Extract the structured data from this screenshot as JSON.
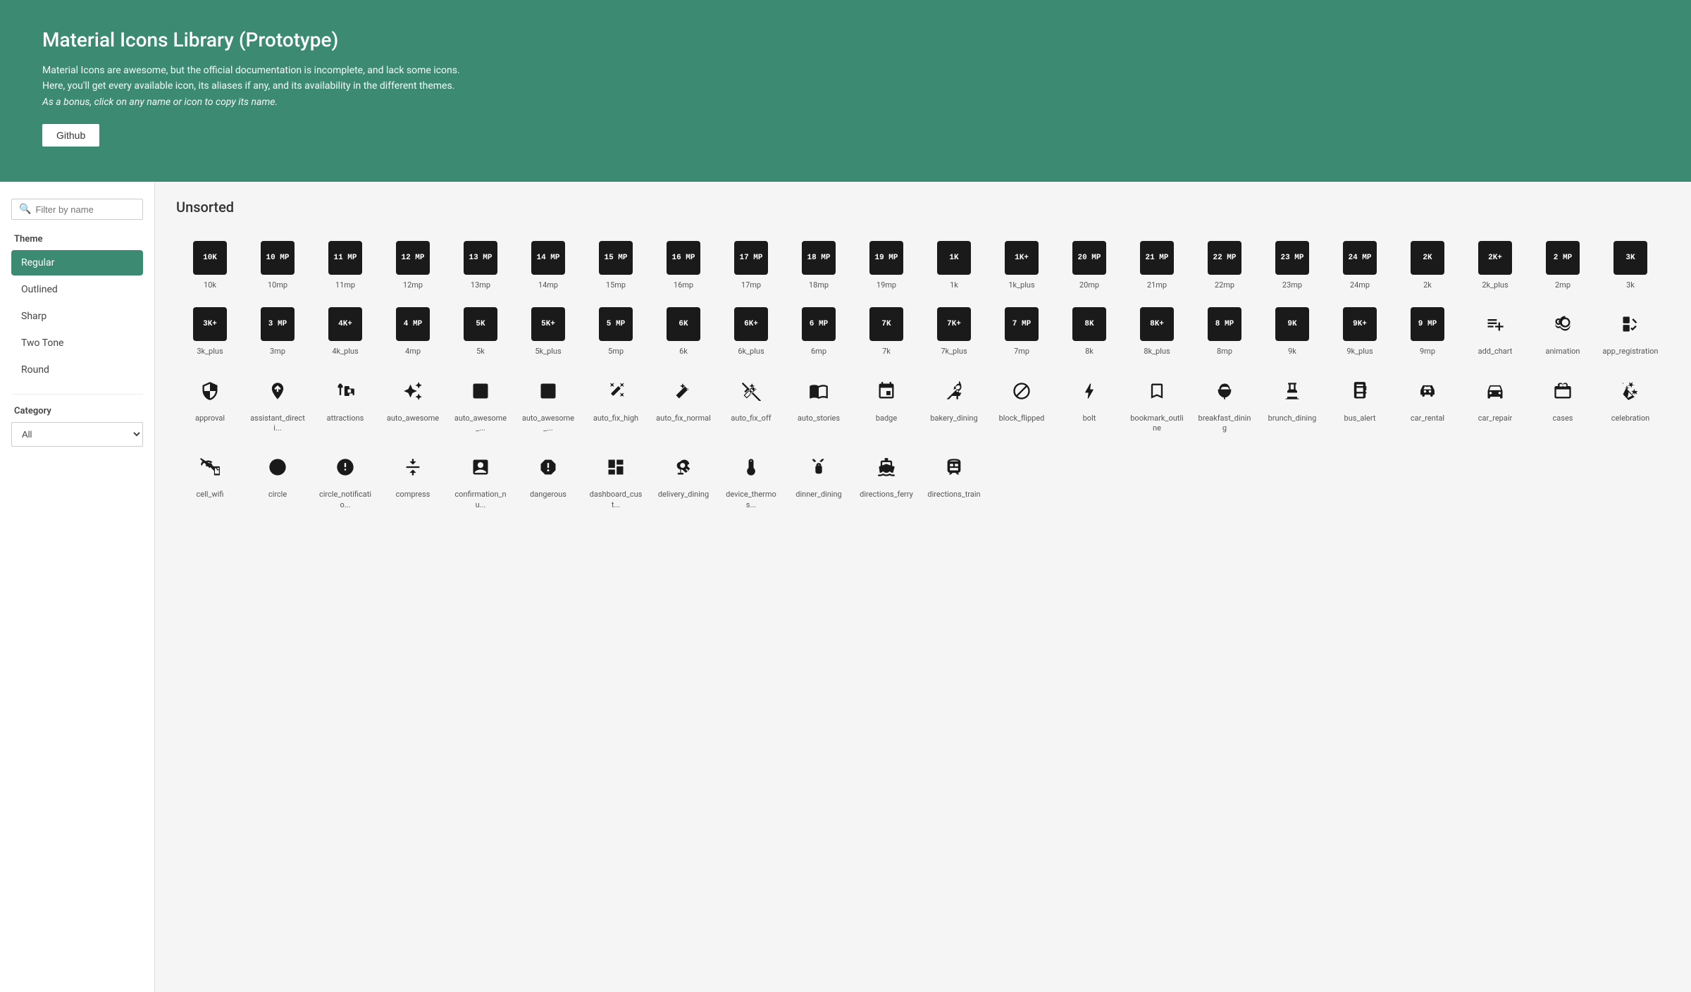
{
  "header": {
    "title": "Material Icons Library (Prototype)",
    "desc1": "Material Icons are awesome, but the official documentation is incomplete, and lack some icons.",
    "desc2": "Here, you'll get every available icon, its aliases if any, and its availability in the different themes.",
    "desc3": "As a bonus, click on any name or icon to copy its name.",
    "github_label": "Github"
  },
  "sidebar": {
    "search_placeholder": "Filter by name",
    "theme_label": "Theme",
    "themes": [
      {
        "id": "regular",
        "label": "Regular",
        "active": true
      },
      {
        "id": "outlined",
        "label": "Outlined",
        "active": false
      },
      {
        "id": "sharp",
        "label": "Sharp",
        "active": false
      },
      {
        "id": "two-tone",
        "label": "Two Tone",
        "active": false
      },
      {
        "id": "round",
        "label": "Round",
        "active": false
      }
    ],
    "category_label": "Category",
    "category_options": [
      {
        "value": "all",
        "label": "All"
      }
    ]
  },
  "content": {
    "title": "Unsorted",
    "icons": [
      {
        "name": "10k",
        "display": "10K"
      },
      {
        "name": "10mp",
        "display": "10\nMP"
      },
      {
        "name": "11mp",
        "display": "11\nMP"
      },
      {
        "name": "12mp",
        "display": "12\nMP"
      },
      {
        "name": "13mp",
        "display": "13\nMP"
      },
      {
        "name": "14mp",
        "display": "14\nMP"
      },
      {
        "name": "15mp",
        "display": "15\nMP"
      },
      {
        "name": "16mp",
        "display": "16\nMP"
      },
      {
        "name": "17mp",
        "display": "17\nMP"
      },
      {
        "name": "18mp",
        "display": "18\nMP"
      },
      {
        "name": "19mp",
        "display": "19\nMP"
      },
      {
        "name": "1k",
        "display": "1K"
      },
      {
        "name": "1k_plus",
        "display": "1K+"
      },
      {
        "name": "20mp",
        "display": "20\nMP"
      },
      {
        "name": "21mp",
        "display": "21\nMP"
      },
      {
        "name": "22mp",
        "display": "22\nMP"
      },
      {
        "name": "23mp",
        "display": "23\nMP"
      },
      {
        "name": "24mp",
        "display": "24\nMP"
      },
      {
        "name": "2k",
        "display": "2K"
      },
      {
        "name": "2k_plus",
        "display": "2K+"
      },
      {
        "name": "2mp",
        "display": "2\nMP"
      },
      {
        "name": "3k",
        "display": "3K"
      },
      {
        "name": "3k_plus",
        "display": "3K+"
      },
      {
        "name": "3mp",
        "display": "3\nMP"
      },
      {
        "name": "4k_plus",
        "display": "4K+"
      },
      {
        "name": "4mp",
        "display": "4\nMP"
      },
      {
        "name": "5k",
        "display": "5K"
      },
      {
        "name": "5k_plus",
        "display": "5K+"
      },
      {
        "name": "5mp",
        "display": "5\nMP"
      },
      {
        "name": "6k",
        "display": "6K"
      },
      {
        "name": "6k_plus",
        "display": "6K+"
      },
      {
        "name": "6mp",
        "display": "6\nMP"
      },
      {
        "name": "7k",
        "display": "7K"
      },
      {
        "name": "7k_plus",
        "display": "7K+"
      },
      {
        "name": "7mp",
        "display": "7\nMP"
      },
      {
        "name": "8k",
        "display": "8K"
      },
      {
        "name": "8k_plus",
        "display": "8K+"
      },
      {
        "name": "8mp",
        "display": "8\nMP"
      },
      {
        "name": "9k",
        "display": "9K"
      },
      {
        "name": "9k_plus",
        "display": "9K+"
      },
      {
        "name": "9mp",
        "display": "9\nMP"
      },
      {
        "name": "add_chart",
        "display": "add_chart",
        "svg": true
      },
      {
        "name": "animation",
        "display": "animation",
        "svg": true
      },
      {
        "name": "app_registration",
        "display": "app_registration",
        "svg": true
      },
      {
        "name": "approval",
        "display": "approval",
        "svg": true
      },
      {
        "name": "assistant_directi...",
        "display": "assistant_directi",
        "svg": true
      },
      {
        "name": "attractions",
        "display": "attractions",
        "svg": true
      },
      {
        "name": "auto_awesome",
        "display": "auto_awesome",
        "svg": true
      },
      {
        "name": "auto_awesome_...",
        "display": "auto_awesome_",
        "svg": true
      },
      {
        "name": "auto_awesome_...",
        "display": "auto_awesome_",
        "svg": true
      },
      {
        "name": "auto_fix_high",
        "display": "auto_fix_high",
        "svg": true
      },
      {
        "name": "auto_fix_normal",
        "display": "auto_fix_normal",
        "svg": true
      },
      {
        "name": "auto_fix_off",
        "display": "auto_fix_off",
        "svg": true
      },
      {
        "name": "auto_stories",
        "display": "auto_stories",
        "svg": true
      },
      {
        "name": "badge",
        "display": "badge",
        "svg": true
      },
      {
        "name": "bakery_dining",
        "display": "bakery_dining",
        "svg": true
      },
      {
        "name": "block_flipped",
        "display": "block_flipped",
        "svg": true
      },
      {
        "name": "bolt",
        "display": "bolt",
        "svg": true
      },
      {
        "name": "bookmark_outline",
        "display": "bookmark_outline",
        "svg": true
      },
      {
        "name": "breakfast_dining",
        "display": "breakfast_dining",
        "svg": true
      },
      {
        "name": "brunch_dining",
        "display": "brunch_dining",
        "svg": true
      },
      {
        "name": "bus_alert",
        "display": "bus_alert",
        "svg": true
      },
      {
        "name": "car_rental",
        "display": "car_rental",
        "svg": true
      },
      {
        "name": "car_repair",
        "display": "car_repair",
        "svg": true
      },
      {
        "name": "cases",
        "display": "cases",
        "svg": true
      },
      {
        "name": "celebration",
        "display": "celebration",
        "svg": true
      },
      {
        "name": "cell_wifi",
        "display": "cell_wifi",
        "svg": true
      },
      {
        "name": "circle",
        "display": "circle",
        "svg": true
      },
      {
        "name": "circle_notificatio...",
        "display": "circle_notificatio",
        "svg": true
      },
      {
        "name": "compress",
        "display": "compress",
        "svg": true
      },
      {
        "name": "confirmation_nu...",
        "display": "confirmation_nu",
        "svg": true
      },
      {
        "name": "dangerous",
        "display": "dangerous",
        "svg": true
      },
      {
        "name": "dashboard_cust...",
        "display": "dashboard_cust",
        "svg": true
      },
      {
        "name": "delivery_dining",
        "display": "delivery_dining",
        "svg": true
      },
      {
        "name": "device_thermos...",
        "display": "device_thermos",
        "svg": true
      },
      {
        "name": "dinner_dining",
        "display": "dinner_dining",
        "svg": true
      },
      {
        "name": "directions_ferry",
        "display": "directions_ferry",
        "svg": true
      },
      {
        "name": "directions_train",
        "display": "directions_train",
        "svg": true
      }
    ]
  }
}
